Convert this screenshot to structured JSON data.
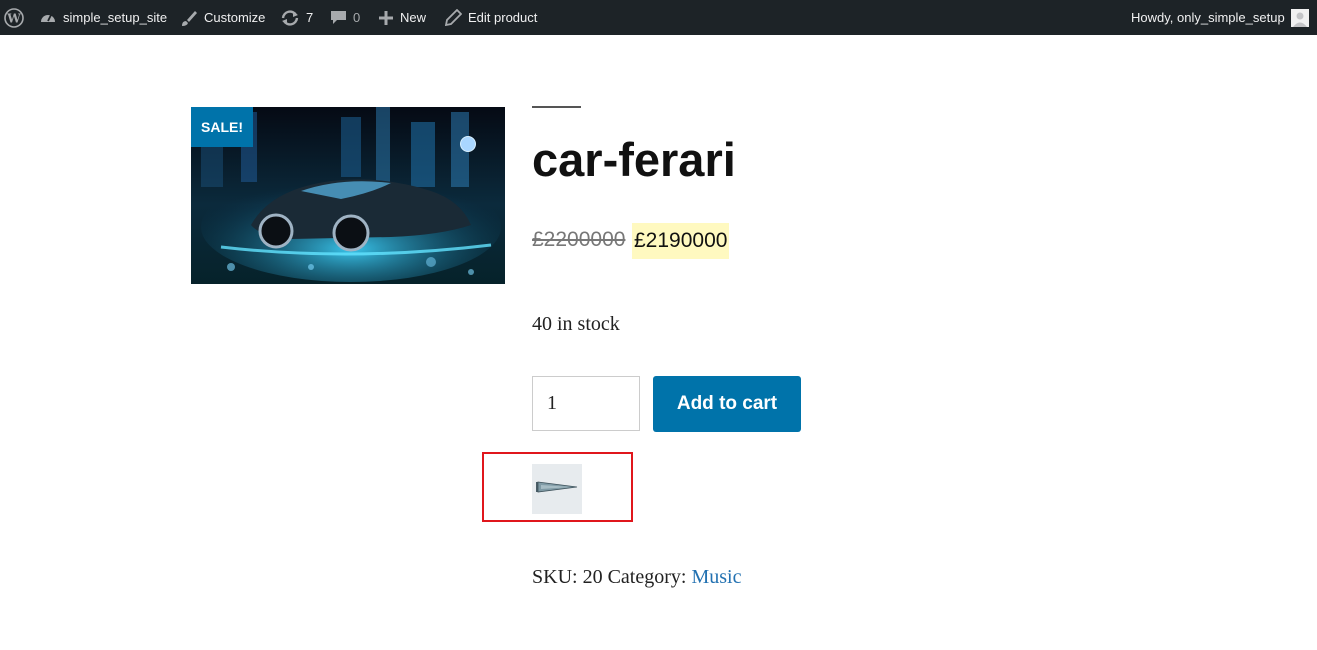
{
  "admin_bar": {
    "site_name": "simple_setup_site",
    "customize_label": "Customize",
    "updates_count": "7",
    "comments_count": "0",
    "new_label": "New",
    "edit_label": "Edit product",
    "greeting": "Howdy, only_simple_setup",
    "icons": [
      "wordpress-logo-icon",
      "dashboard-icon",
      "brush-icon",
      "updates-icon",
      "comment-icon",
      "plus-icon",
      "pencil-icon",
      "avatar-icon"
    ]
  },
  "product": {
    "sale_badge": "SALE!",
    "title": "car-ferari",
    "regular_price": "£2200000",
    "sale_price": "£2190000",
    "stock": "40 in stock",
    "quantity": "1",
    "add_to_cart_label": "Add to cart",
    "sku_label": "SKU:",
    "sku": "20",
    "category_label": "Category:",
    "category": "Music",
    "thumbnail_icon": "pennant-icon",
    "accent_color": "#0073aa",
    "highlight_color": "#e0161c"
  }
}
